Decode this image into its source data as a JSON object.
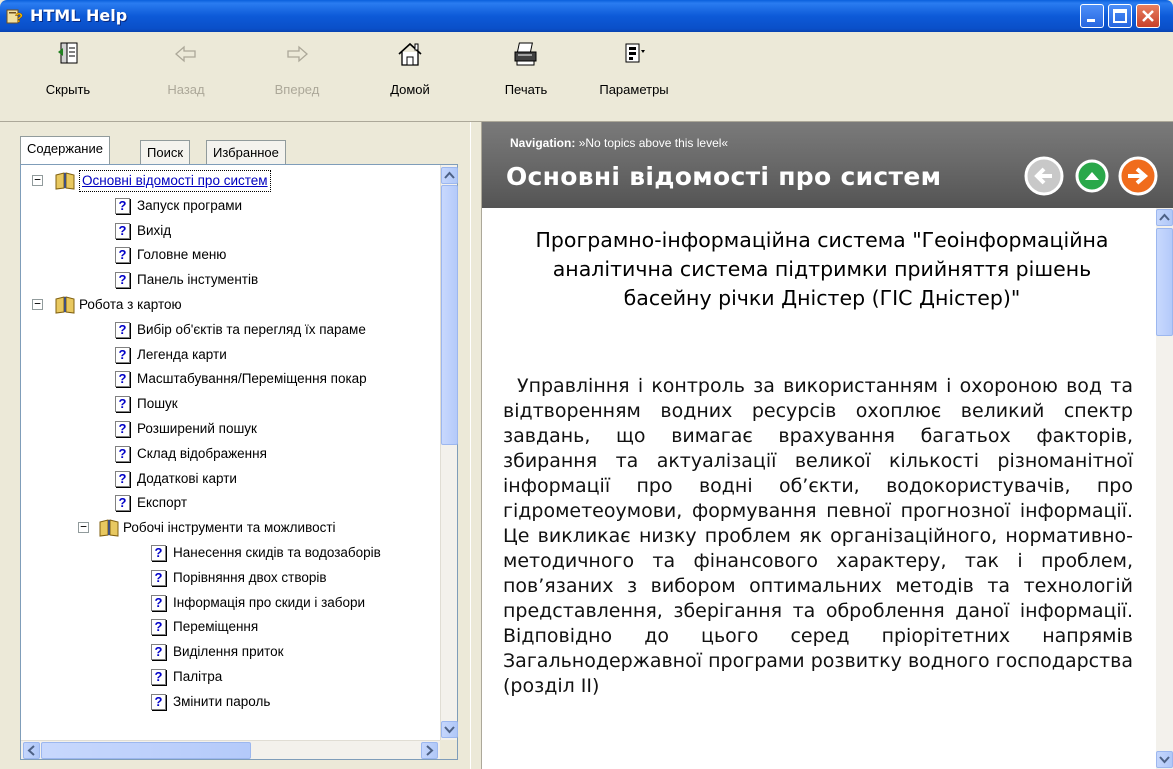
{
  "window": {
    "title": "HTML Help"
  },
  "toolbar": {
    "hide_label": "Скрыть",
    "back_label": "Назад",
    "forward_label": "Вперед",
    "home_label": "Домой",
    "print_label": "Печать",
    "options_label": "Параметры"
  },
  "tabs": {
    "contents": "Содержание",
    "search": "Поиск",
    "favorites": "Избранное"
  },
  "tree": {
    "root1": "Основні відомості про систем",
    "root1_items": [
      "Запуск програми",
      "Вихід",
      "Головне меню",
      "Панель інстументів"
    ],
    "root2": "Робота з картою",
    "root2_items": [
      "Вибір об'єктів та перегляд їх параме",
      "Легенда карти",
      "Масштабування/Переміщення покар",
      "Пошук",
      "Розширений пошук",
      "Склад відображення",
      "Додаткові карти",
      "Експорт"
    ],
    "sub1": "Робочі інструменти та можливості",
    "sub1_items": [
      "Нанесення скидів та водозаборів",
      "Порівняння двох створів",
      "Інформація про скиди і забори",
      "Переміщення",
      "Виділення приток",
      "Палітра",
      "Змінити пароль"
    ]
  },
  "navigation": {
    "key": "Navigation:",
    "text": "»No topics above this level«",
    "heading": "Основні відомості про систем"
  },
  "document": {
    "title": "Програмно-інформаційна система \"Геоінформаційна аналітична система підтримки прийняття рішень басейну річки Дністер (ГІС Дністер)\"",
    "paragraph": "Управління і контроль за використанням і охороною вод та відтворенням водних ресурсів охоплює великий спектр завдань, що вимагає врахування багатьох факторів, збирання та актуалізації великої кількості різноманітної інформації про водні об’єкти, водокористувачів, про гідрометеоумови, формування певної прогнозної інформації. Це викликає низку проблем як організаційного, нормативно-методичного та фінансового характеру, так і проблем, пов’язаних з вибором оптимальних методів та технологій представлення, зберігання та оброблення даної інформації. Відповідно до цього серед пріорітетних напрямів Загальнодержавної програми розвитку водного господарства (розділ II)"
  },
  "colors": {
    "titlebar": "#0a5fdc",
    "navbar": "#6a6a6a",
    "selection": "#0000c0"
  }
}
